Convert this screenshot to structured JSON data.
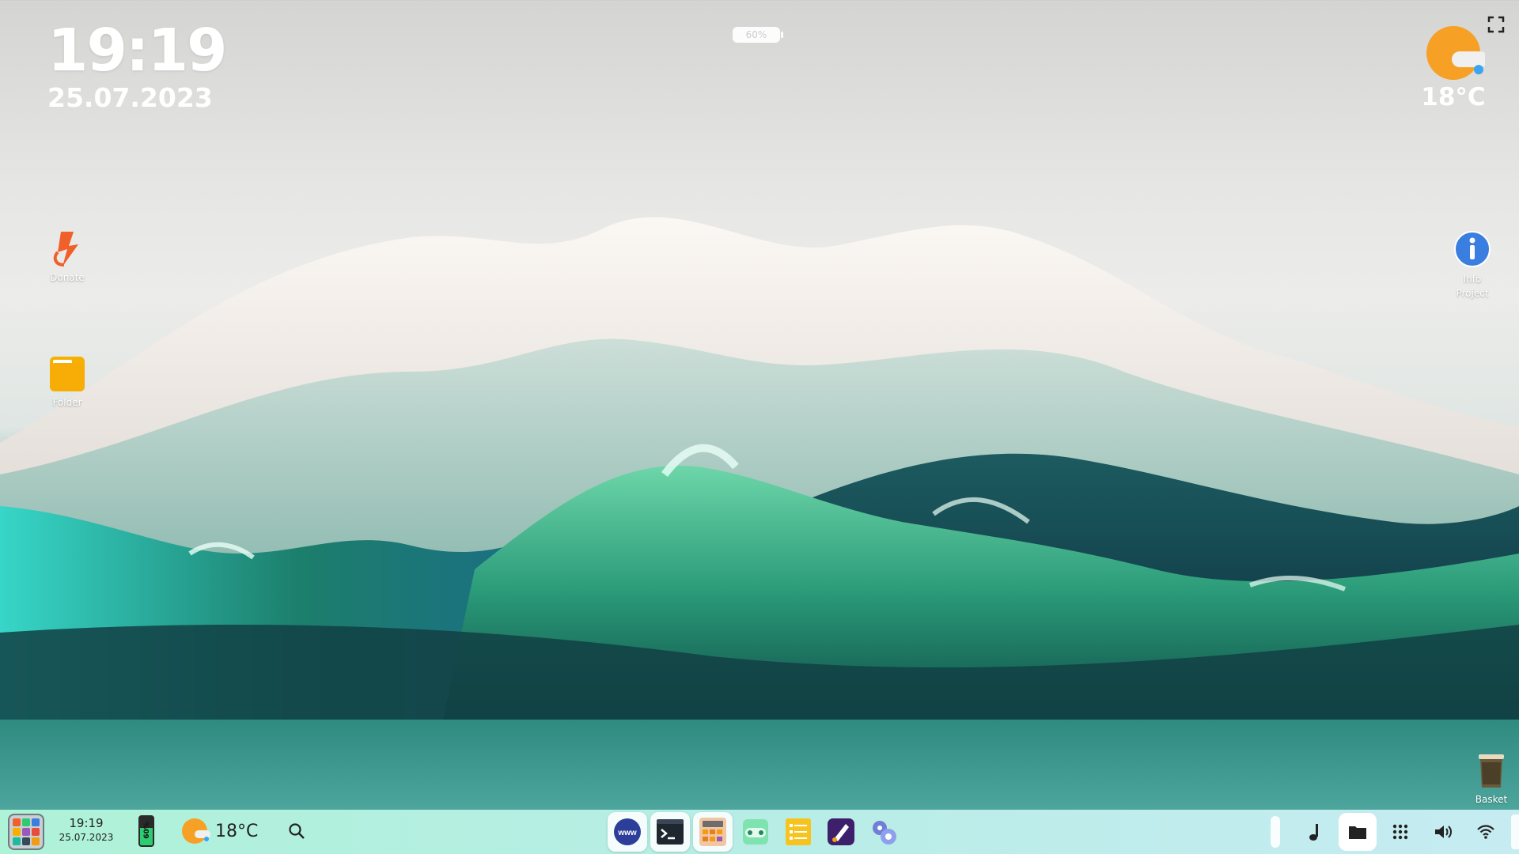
{
  "clock": {
    "time": "19:19",
    "date": "25.07.2023"
  },
  "top_battery": {
    "label": "60%",
    "level": 60
  },
  "weather": {
    "temp": "18°C",
    "icon": "sun-cloud-icon"
  },
  "desktop_icons": [
    {
      "label": "Donate",
      "icon": "donate-bolt-icon"
    },
    {
      "label": "Folder",
      "icon": "folder-icon"
    },
    {
      "label": "Info Project",
      "icon": "info-icon"
    },
    {
      "label": "Basket",
      "icon": "trash-basket-icon"
    }
  ],
  "taskbar": {
    "time": "19:19",
    "date": "25.07.2023",
    "battery_label": "60%",
    "battery_level": 60,
    "weather_temp": "18°C",
    "apps": [
      {
        "name": "www",
        "label": "www",
        "icon": "browser-www-icon"
      },
      {
        "name": "terminal",
        "icon": "terminal-icon"
      },
      {
        "name": "calculator",
        "icon": "calculator-icon"
      },
      {
        "name": "games",
        "icon": "gamepad-icon"
      },
      {
        "name": "notes",
        "icon": "notes-list-icon"
      },
      {
        "name": "paint",
        "icon": "paint-icon"
      },
      {
        "name": "settings",
        "icon": "settings-gears-icon"
      }
    ],
    "tray": [
      "music-note-icon",
      "folder-icon",
      "apps-grid-icon",
      "volume-icon",
      "wifi-icon"
    ]
  }
}
